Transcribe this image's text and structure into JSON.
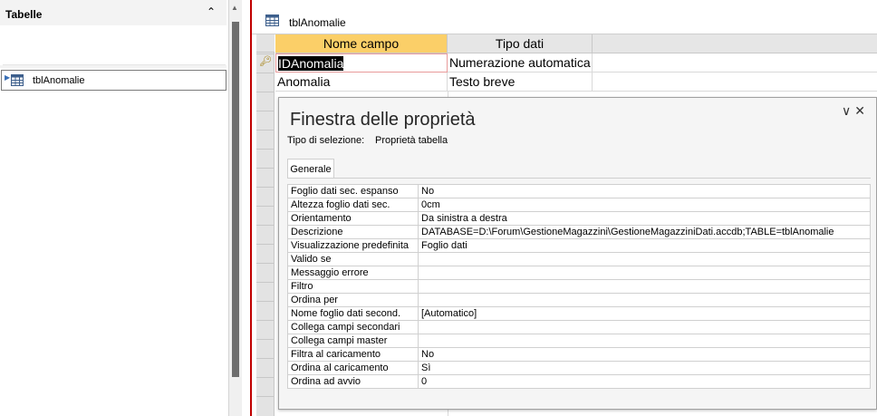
{
  "nav": {
    "title": "Tabelle",
    "items": [
      {
        "label": "tblAnomalie"
      }
    ]
  },
  "document": {
    "tab_label": "tblAnomalie",
    "columns": {
      "field_name": "Nome campo",
      "data_type": "Tipo dati"
    },
    "rows": [
      {
        "field_name": "IDAnomalia",
        "data_type": "Numerazione automatica",
        "primary_key": true
      },
      {
        "field_name": "Anomalia",
        "data_type": "Testo breve",
        "primary_key": false
      }
    ]
  },
  "property_sheet": {
    "title": "Finestra delle proprietà",
    "selection_type_label": "Tipo di selezione:",
    "selection_type_value": "Proprietà tabella",
    "tab": "Generale",
    "properties": [
      {
        "name": "Foglio dati sec. espanso",
        "value": "No"
      },
      {
        "name": "Altezza foglio dati sec.",
        "value": "0cm"
      },
      {
        "name": "Orientamento",
        "value": "Da sinistra a destra"
      },
      {
        "name": "Descrizione",
        "value": "DATABASE=D:\\Forum\\GestioneMagazzini\\GestioneMagazziniDati.accdb;TABLE=tblAnomalie"
      },
      {
        "name": "Visualizzazione predefinita",
        "value": "Foglio dati"
      },
      {
        "name": "Valido se",
        "value": ""
      },
      {
        "name": "Messaggio errore",
        "value": ""
      },
      {
        "name": "Filtro",
        "value": ""
      },
      {
        "name": "Ordina per",
        "value": ""
      },
      {
        "name": "Nome foglio dati second.",
        "value": "[Automatico]"
      },
      {
        "name": "Collega campi secondari",
        "value": ""
      },
      {
        "name": "Collega campi master",
        "value": ""
      },
      {
        "name": "Filtra al caricamento",
        "value": "No"
      },
      {
        "name": "Ordina al caricamento",
        "value": "Sì"
      },
      {
        "name": "Ordina ad avvio",
        "value": "0"
      }
    ]
  },
  "icons": {
    "collapse": "chevron-up-icon",
    "table": "table-icon",
    "primary_key": "key-icon",
    "dropdown": "chevron-down-icon",
    "close": "close-icon"
  }
}
